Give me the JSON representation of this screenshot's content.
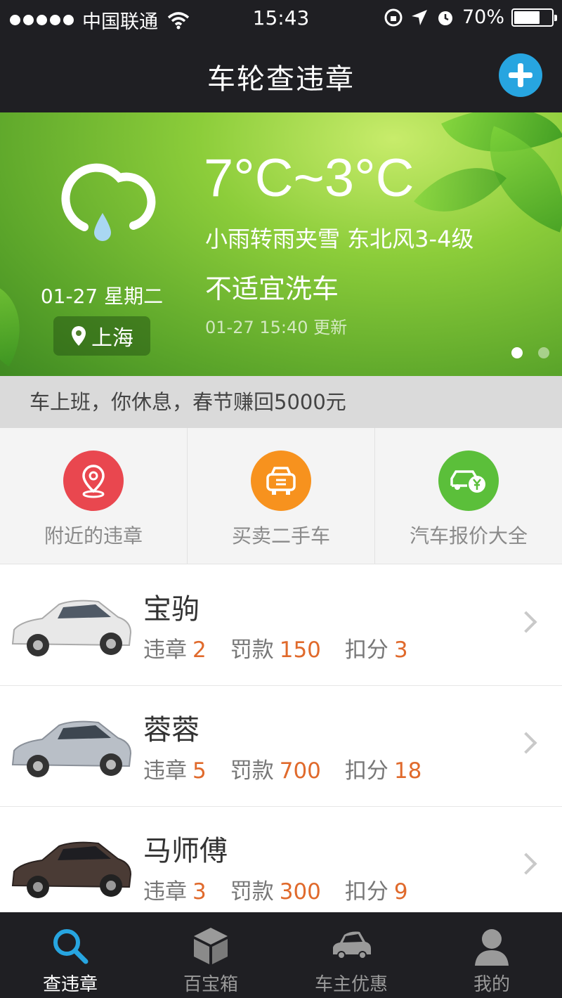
{
  "status_bar": {
    "carrier": "中国联通",
    "time": "15:43",
    "battery_percent_text": "70%",
    "battery_level": 0.7
  },
  "nav": {
    "title": "车轮查违章",
    "add_icon": "plus-circle-icon"
  },
  "weather": {
    "icon": "cloud-rain-drop-icon",
    "date": "01-27 星期二",
    "city": "上海",
    "temperature": "7°C~3°C",
    "condition": "小雨转雨夹雪 东北风3-4级",
    "car_wash_advice": "不适宜洗车",
    "updated": "01-27 15:40 更新",
    "page_count": 2,
    "active_page": 0
  },
  "promo": {
    "text": "车上班，你休息，春节赚回5000元"
  },
  "quick_actions": [
    {
      "label": "附近的违章",
      "icon": "location-pin-icon",
      "color": "#e9474f"
    },
    {
      "label": "买卖二手车",
      "icon": "car-sale-icon",
      "color": "#f7921e"
    },
    {
      "label": "汽车报价大全",
      "icon": "car-price-icon",
      "color": "#5bbf3a"
    }
  ],
  "cars": [
    {
      "name": "宝驹",
      "violations_label": "违章",
      "violations": "2",
      "fine_label": "罚款",
      "fine": "150",
      "points_label": "扣分",
      "points": "3",
      "car_color": "#e8e8e8"
    },
    {
      "name": "蓉蓉",
      "violations_label": "违章",
      "violations": "5",
      "fine_label": "罚款",
      "fine": "700",
      "points_label": "扣分",
      "points": "18",
      "car_color": "#b9bfc7"
    },
    {
      "name": "马师傅",
      "violations_label": "违章",
      "violations": "3",
      "fine_label": "罚款",
      "fine": "300",
      "points_label": "扣分",
      "points": "9",
      "car_color": "#4a3b35"
    }
  ],
  "tabs": [
    {
      "label": "查违章",
      "icon": "search-icon",
      "active": true
    },
    {
      "label": "百宝箱",
      "icon": "box-icon",
      "active": false
    },
    {
      "label": "车主优惠",
      "icon": "car-icon",
      "active": false
    },
    {
      "label": "我的",
      "icon": "user-icon",
      "active": false
    }
  ],
  "colors": {
    "dark_bar": "#1f1f23",
    "accent_blue": "#27a5e0",
    "highlight_orange": "#e06a2c"
  }
}
